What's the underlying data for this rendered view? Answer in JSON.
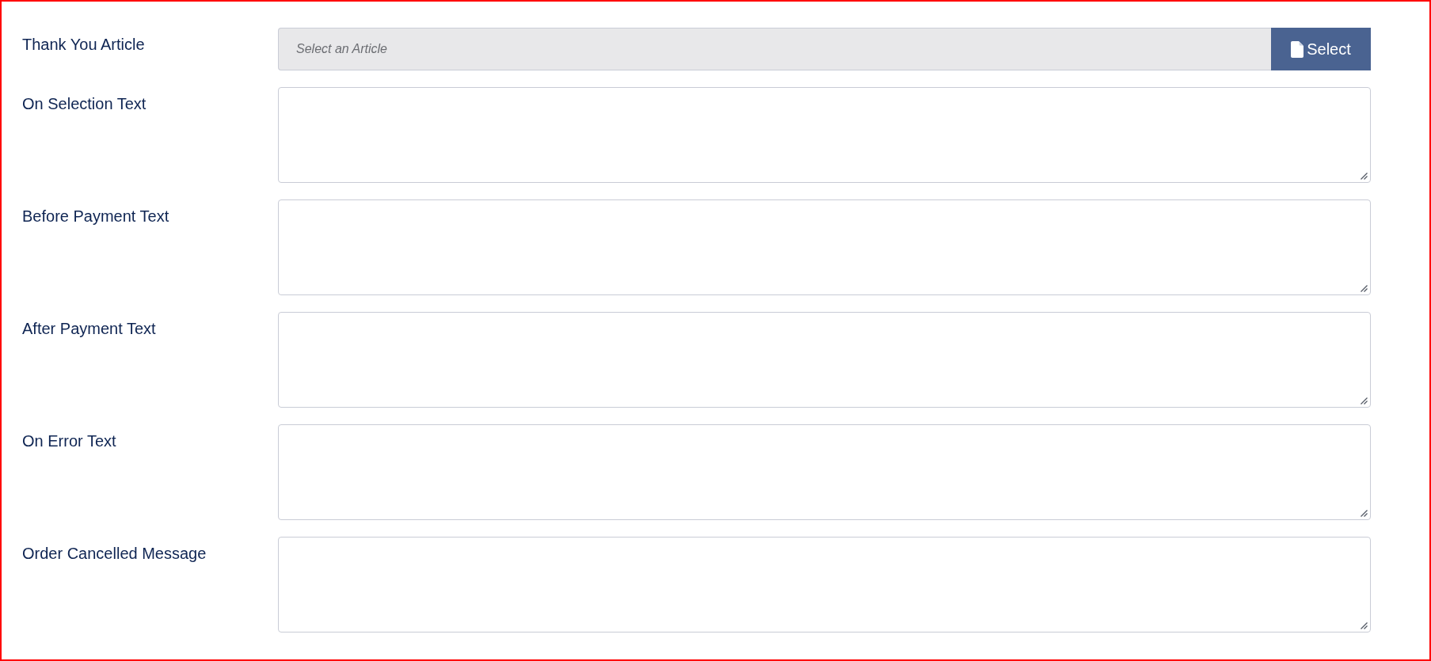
{
  "fields": [
    {
      "kind": "picker",
      "label": "Thank You Article",
      "placeholder": "Select an Article",
      "button": "Select"
    },
    {
      "kind": "textarea",
      "label": "On Selection Text"
    },
    {
      "kind": "textarea",
      "label": "Before Payment Text"
    },
    {
      "kind": "textarea",
      "label": "After Payment Text"
    },
    {
      "kind": "textarea",
      "label": "On Error Text"
    },
    {
      "kind": "textarea",
      "label": "Order Cancelled Message"
    }
  ]
}
